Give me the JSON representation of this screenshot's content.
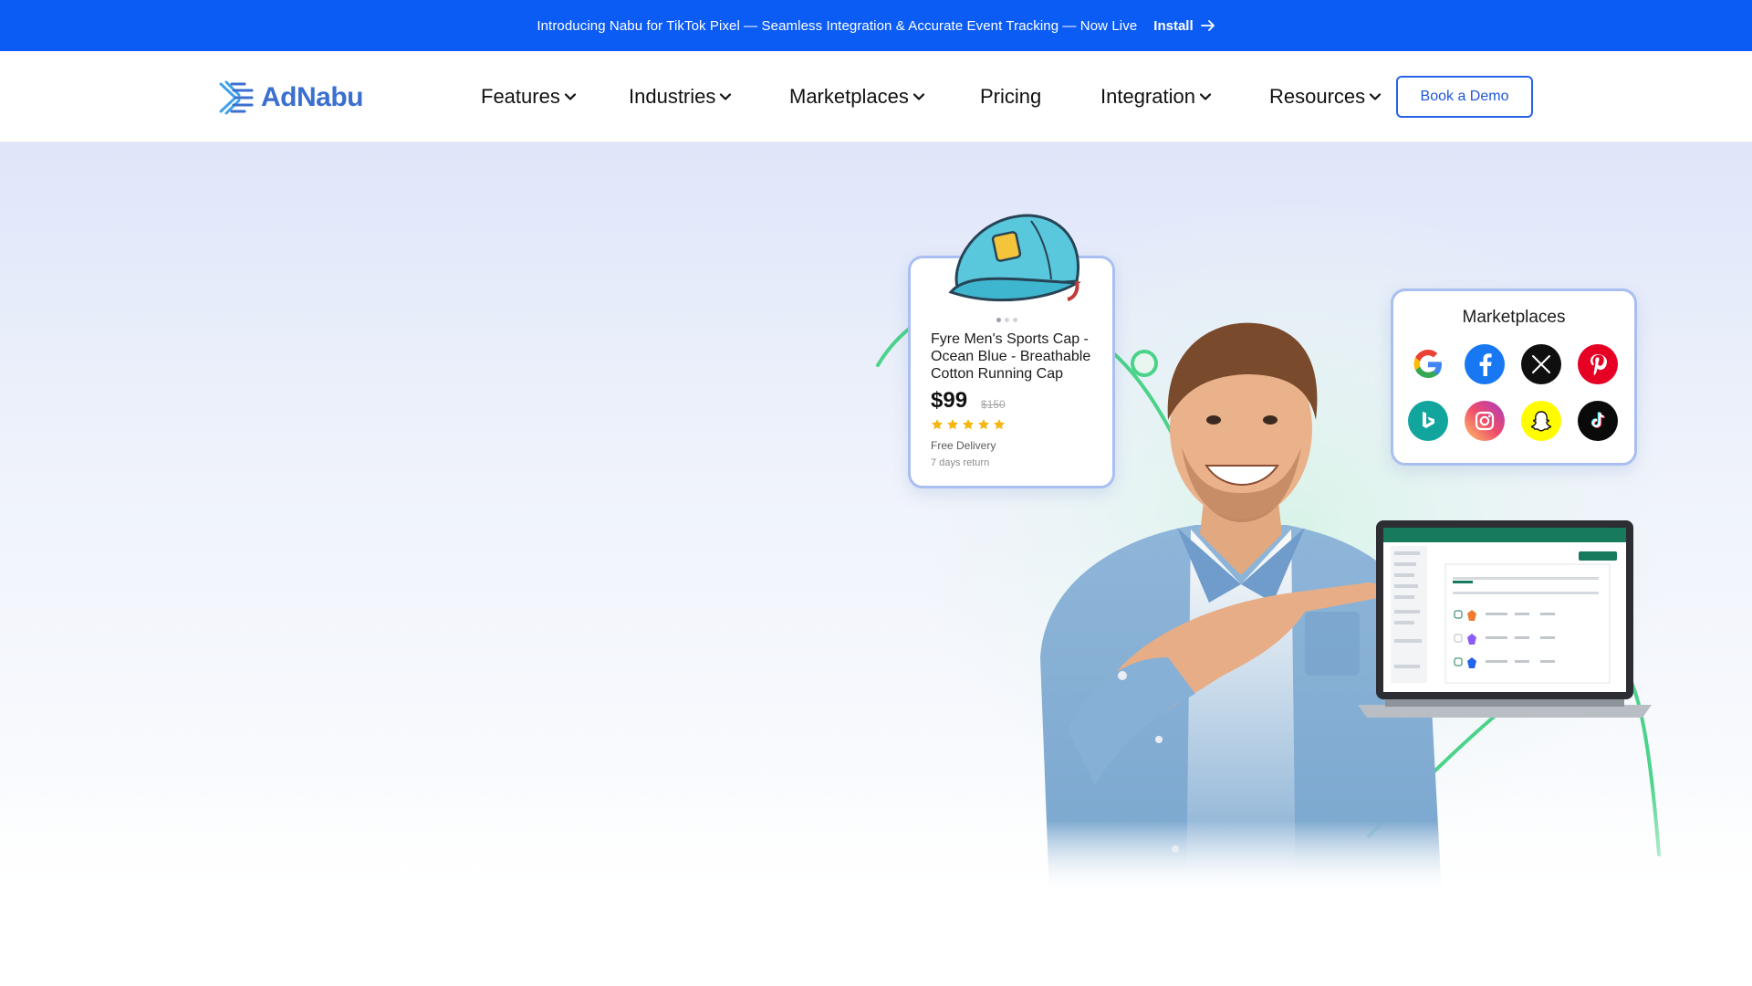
{
  "announcement": {
    "text": "Introducing Nabu for TikTok Pixel — Seamless Integration & Accurate Event Tracking — Now Live",
    "link_label": "Install"
  },
  "header": {
    "logo_text": "AdNabu",
    "nav": [
      {
        "label": "Features",
        "dropdown": true
      },
      {
        "label": "Industries",
        "dropdown": true
      },
      {
        "label": "Marketplaces",
        "dropdown": true
      },
      {
        "label": "Pricing",
        "dropdown": false
      },
      {
        "label": "Integration",
        "dropdown": true
      },
      {
        "label": "Resources",
        "dropdown": true
      }
    ],
    "cta_label": "Book a Demo"
  },
  "product_card": {
    "title": "Fyre Men's Sports Cap - Ocean Blue - Breathable Cotton Running Cap",
    "price": "$99",
    "old_price": "$150",
    "rating": 5,
    "delivery": "Free Delivery",
    "returns": "7 days return"
  },
  "marketplaces_card": {
    "title": "Marketplaces",
    "icons": [
      "google-icon",
      "facebook-icon",
      "x-icon",
      "pinterest-icon",
      "bing-icon",
      "instagram-icon",
      "snapchat-icon",
      "tiktok-icon"
    ]
  },
  "colors": {
    "announcement_bg": "#0b5cf5",
    "brand_blue": "#3b6fd0",
    "accent_green": "#4cd38a",
    "card_border": "#a9bff2"
  }
}
